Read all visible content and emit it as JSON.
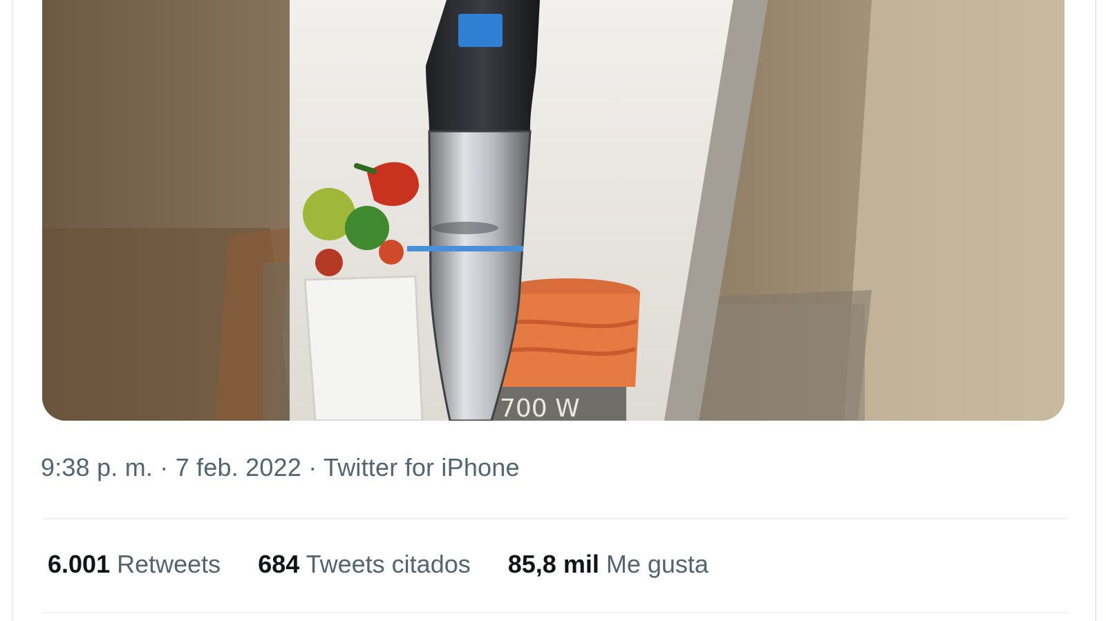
{
  "tweet": {
    "media": {
      "alt": "Caja de batidora de mano",
      "box_label": "700 W"
    },
    "meta": {
      "time": "9:38 p. m.",
      "separator": " · ",
      "date": "7 feb. 2022",
      "source": "Twitter for iPhone"
    },
    "stats": [
      {
        "value": "6.001",
        "label": "Retweets"
      },
      {
        "value": "684",
        "label": "Tweets citados"
      },
      {
        "value": "85,8 mil",
        "label": "Me gusta"
      }
    ]
  }
}
